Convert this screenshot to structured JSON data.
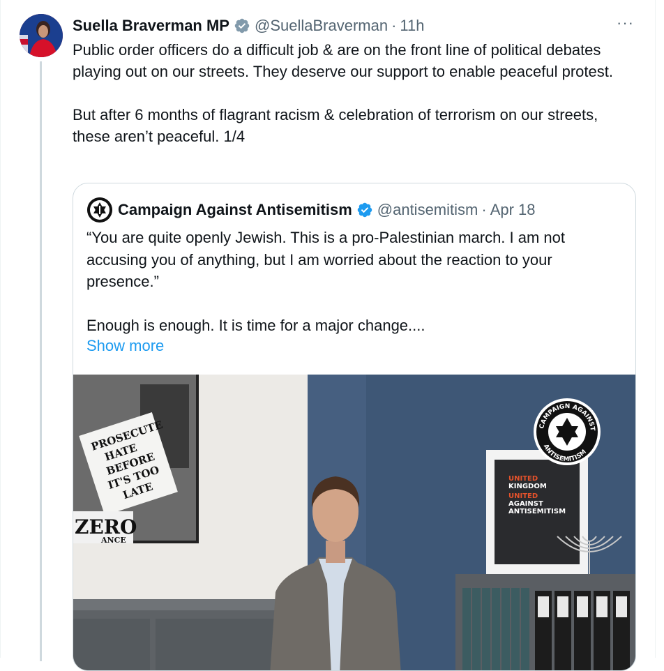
{
  "tweet": {
    "author_name": "Suella Braverman MP",
    "handle": "@SuellaBraverman",
    "separator": "·",
    "time": "11h",
    "more_label": "···",
    "text": "Public order officers do a difficult job & are on the front line of political debates playing out on our streets. They deserve our support to enable peaceful protest.\n\nBut after 6 months of flagrant racism & celebration of terrorism on our streets, these aren’t peaceful. 1/4"
  },
  "quote": {
    "author_name": "Campaign Against Antisemitism",
    "handle": "@antisemitism",
    "separator": "·",
    "time": "Apr 18",
    "text": "“You are quite openly Jewish. This is a pro-Palestinian march. I am not accusing you of anything, but I am worried about the reaction to your presence.”\n\nEnough is enough. It is time for a major change....",
    "show_more": "Show more"
  },
  "media": {
    "placards": [
      "PROSECUTE",
      "HATE",
      "BEFORE",
      "IT'S TOO",
      "LATE"
    ],
    "zero_sign": "ZERO",
    "zero_sign_sub": "ANCE",
    "logo_top": "CAMPAIGN AGAINST",
    "logo_bottom": "ANTISEMITISM",
    "poster_lines": [
      "UNITED",
      "KINGDOM",
      "UNITED",
      "AGAINST",
      "ANTISEMITISM"
    ]
  },
  "colors": {
    "verified": "#1d9bf0",
    "link": "#1d9bf0",
    "muted": "#536471",
    "wall": "#3e5776"
  }
}
